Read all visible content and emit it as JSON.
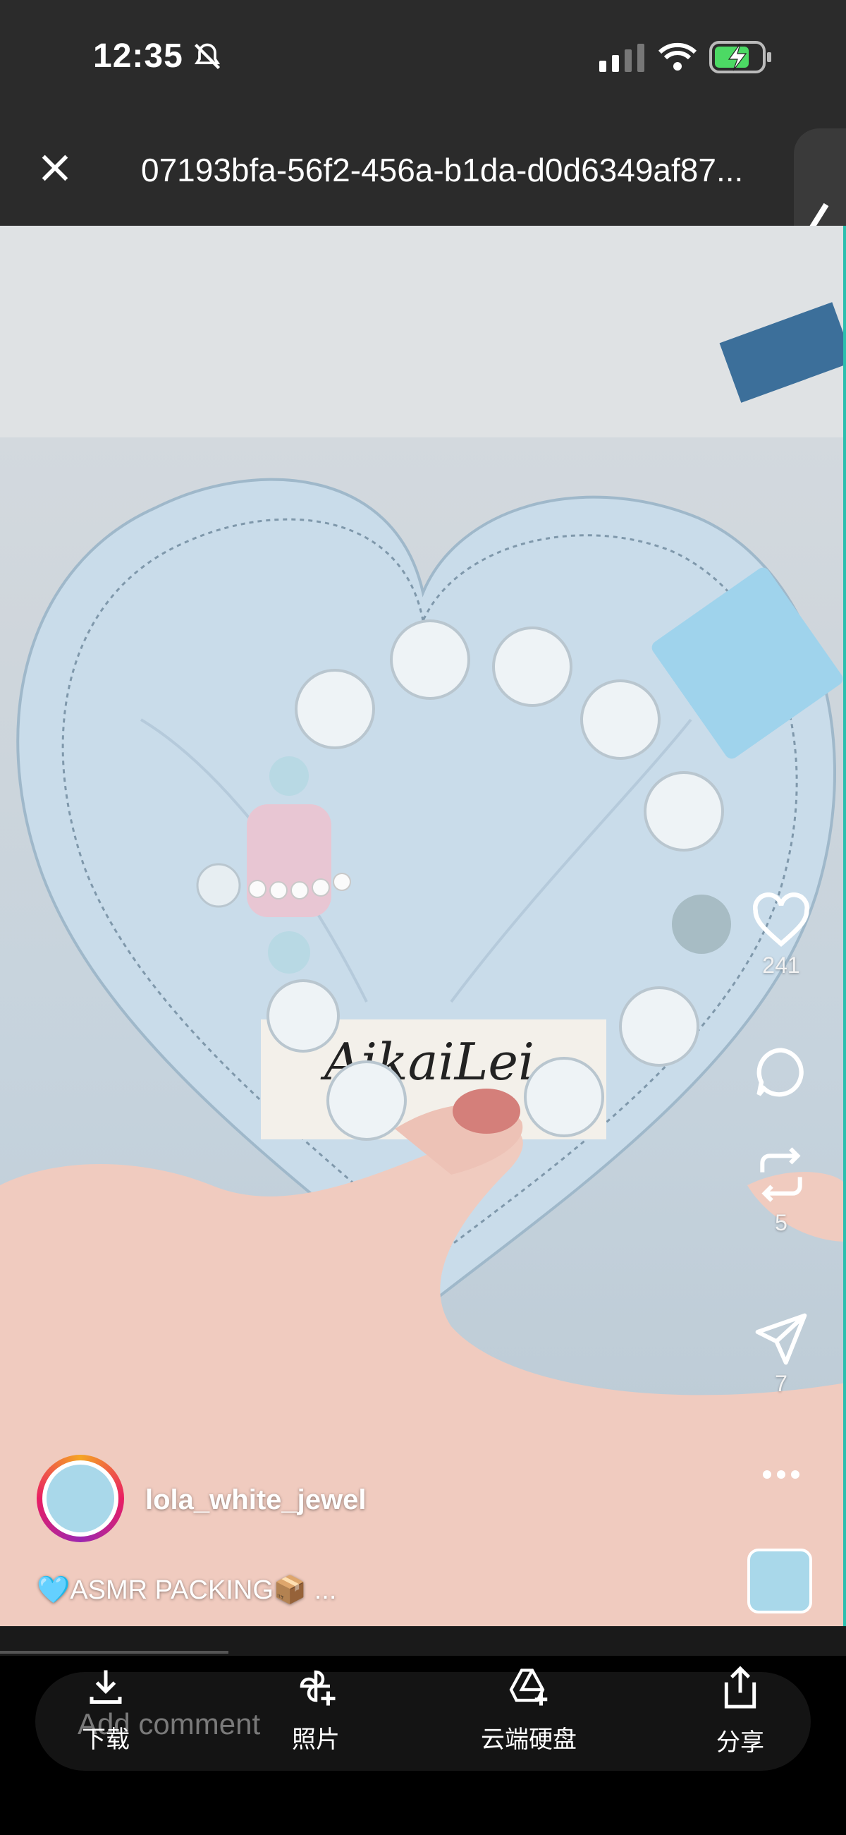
{
  "status_bar": {
    "time": "12:35"
  },
  "header": {
    "file_name": "07193bfa-56f2-456a-b1da-d0d6349af87..."
  },
  "post": {
    "username": "lola_white_jewel",
    "caption": "🩵ASMR PACKING📦 ...",
    "image_caption_text": "AikaiLei"
  },
  "actions": {
    "likes": "241",
    "reposts": "5",
    "shares": "7"
  },
  "comment": {
    "placeholder": "Add comment"
  },
  "toolbar": [
    {
      "label": "下载",
      "icon": "download-icon"
    },
    {
      "label": "照片",
      "icon": "photos-icon"
    },
    {
      "label": "云端硬盘",
      "icon": "drive-icon"
    },
    {
      "label": "分享",
      "icon": "share-icon"
    }
  ],
  "progress": {
    "fraction": 0.27
  }
}
